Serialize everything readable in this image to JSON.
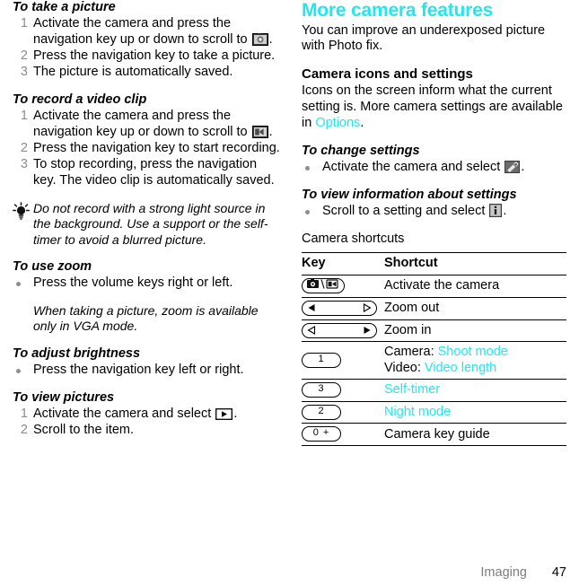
{
  "left_column": {
    "sections": [
      {
        "type": "procedure",
        "heading": "To take a picture",
        "steps": [
          {
            "num": "1",
            "text_before": "Activate the camera and press the navigation key up or down to scroll to ",
            "icon": "camera-icon",
            "text_after": "."
          },
          {
            "num": "2",
            "text_before": "Press the navigation key to take a picture.",
            "icon": null,
            "text_after": ""
          },
          {
            "num": "3",
            "text_before": "The picture is automatically saved.",
            "icon": null,
            "text_after": ""
          }
        ]
      },
      {
        "type": "procedure",
        "heading": "To record a video clip",
        "steps": [
          {
            "num": "1",
            "text_before": "Activate the camera and press the navigation key up or down to scroll to ",
            "icon": "video-camera-icon",
            "text_after": "."
          },
          {
            "num": "2",
            "text_before": "Press the navigation key to start recording.",
            "icon": null,
            "text_after": ""
          },
          {
            "num": "3",
            "text_before": "To stop recording, press the navigation key. The video clip is automatically saved.",
            "icon": null,
            "text_after": ""
          }
        ]
      },
      {
        "type": "tip",
        "icon": "lightbulb-icon",
        "text": "Do not record with a strong light source in the background. Use a support or the self-timer to avoid a blurred picture."
      },
      {
        "type": "bullet_procedure",
        "heading": "To use zoom",
        "bullets": [
          "Press the volume keys right or left."
        ]
      },
      {
        "type": "caution",
        "icon": "exclamation-icon",
        "text": "When taking a picture, zoom is available only in VGA mode."
      },
      {
        "type": "bullet_procedure",
        "heading": "To adjust brightness",
        "bullets": [
          "Press the navigation key left or right."
        ]
      },
      {
        "type": "procedure",
        "heading": "To view pictures",
        "steps": [
          {
            "num": "1",
            "text_before": "Activate the camera and select ",
            "icon": "play-icon",
            "text_after": "."
          },
          {
            "num": "2",
            "text_before": "Scroll to the item.",
            "icon": null,
            "text_after": ""
          }
        ]
      }
    ]
  },
  "right_column": {
    "title": "More camera features",
    "intro": "You can improve an underexposed picture with Photo fix.",
    "subsection_heading": "Camera icons and settings",
    "subsection_body_before": "Icons on the screen inform what the current setting is. More camera settings are available in ",
    "subsection_link": "Options",
    "subsection_body_after": ".",
    "change_settings": {
      "heading": "To change settings",
      "bullet_before": "Activate the camera and select ",
      "icon": "wrench-settings-icon",
      "bullet_after": "."
    },
    "view_info": {
      "heading": "To view information about settings",
      "bullet_before": "Scroll to a setting and select ",
      "icon": "info-icon",
      "bullet_after": "."
    },
    "shortcuts_heading": "Camera shortcuts",
    "table": {
      "columns": [
        "Key",
        "Shortcut"
      ],
      "rows": [
        {
          "key_icon": "camera-video-key",
          "key_label": "",
          "shortcut_parts": [
            {
              "text": "Activate the camera",
              "color": "black"
            }
          ]
        },
        {
          "key_icon": "volume-rocker-left-key",
          "key_label": "",
          "shortcut_parts": [
            {
              "text": "Zoom out",
              "color": "black"
            }
          ]
        },
        {
          "key_icon": "volume-rocker-right-key",
          "key_label": "",
          "shortcut_parts": [
            {
              "text": "Zoom in",
              "color": "black"
            }
          ]
        },
        {
          "key_icon": "number-key",
          "key_label": "1",
          "shortcut_parts": [
            {
              "text": "Camera: ",
              "color": "black"
            },
            {
              "text": "Shoot mode",
              "color": "cyan"
            },
            {
              "text": "\n",
              "color": "break"
            },
            {
              "text": "Video: ",
              "color": "black"
            },
            {
              "text": "Video length",
              "color": "cyan"
            }
          ]
        },
        {
          "key_icon": "number-key",
          "key_label": "3",
          "shortcut_parts": [
            {
              "text": "Self-timer",
              "color": "cyan"
            }
          ]
        },
        {
          "key_icon": "number-key",
          "key_label": "2",
          "shortcut_parts": [
            {
              "text": "Night mode",
              "color": "cyan"
            }
          ]
        },
        {
          "key_icon": "number-key",
          "key_label": "0 +",
          "shortcut_parts": [
            {
              "text": "Camera key guide",
              "color": "black"
            }
          ]
        }
      ]
    }
  },
  "footer": {
    "chapter": "Imaging",
    "page_number": "47"
  },
  "colors": {
    "link_cyan": "#22e8ee",
    "step_number_gray": "#8c8c8c",
    "footer_gray": "#7d7d7d",
    "text_black": "#000000",
    "background": "#ffffff"
  }
}
